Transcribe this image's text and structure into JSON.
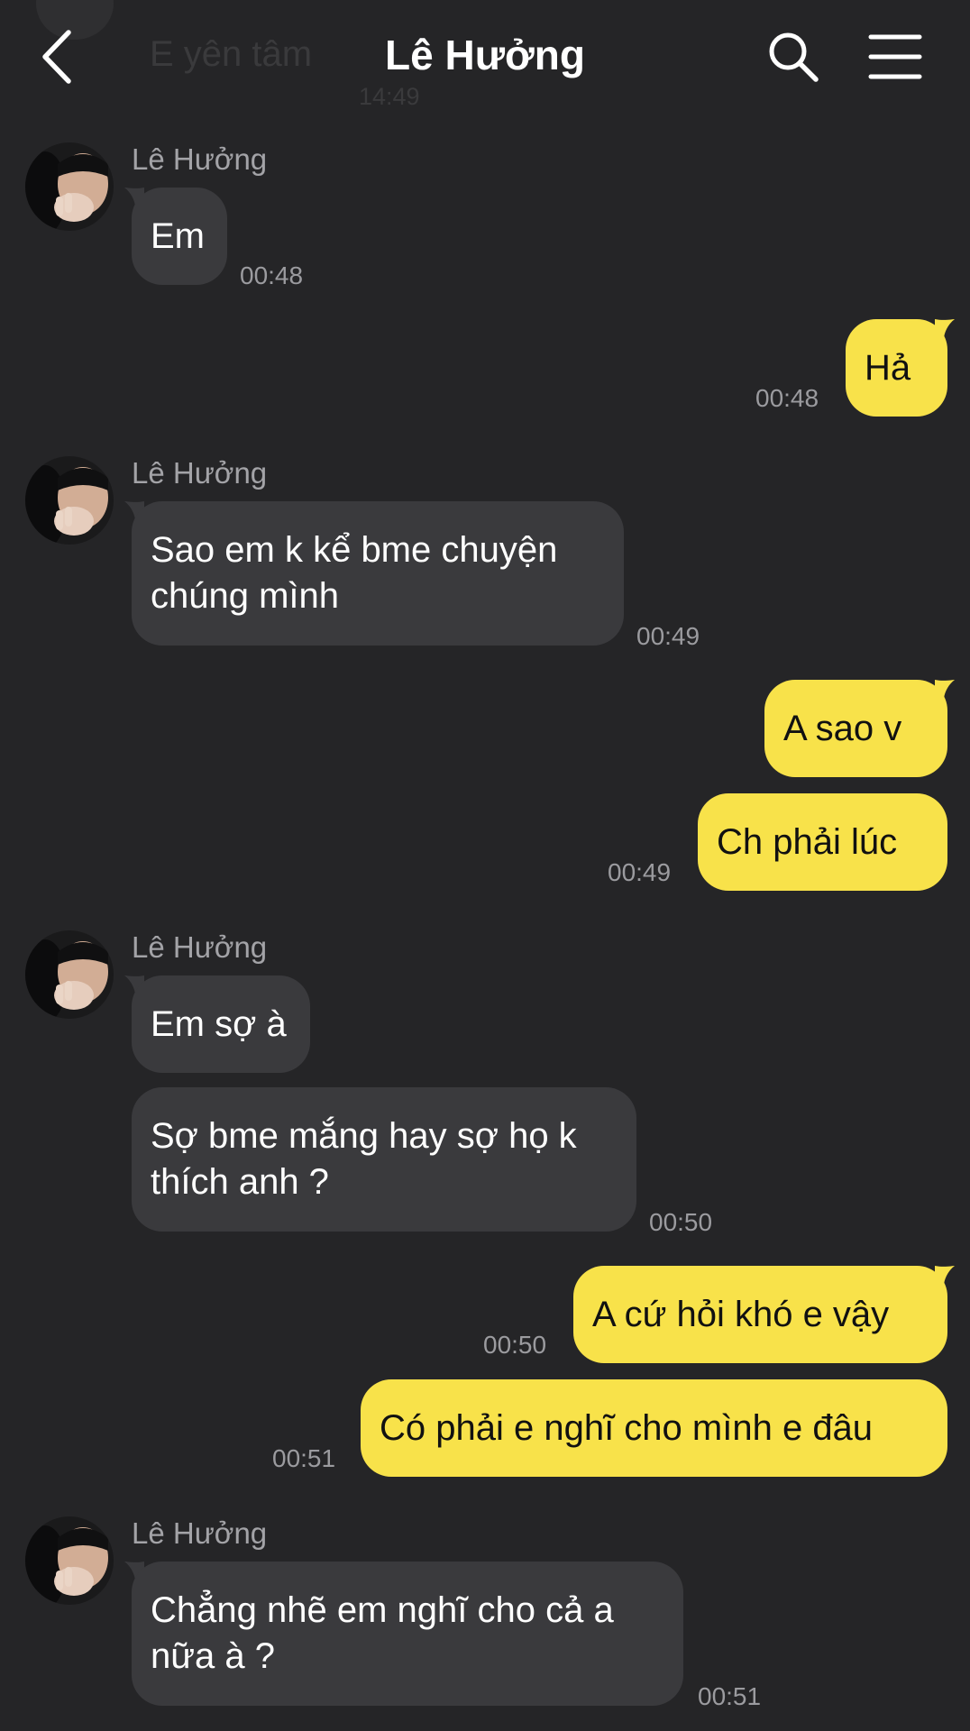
{
  "header": {
    "title": "Lê Hưởng",
    "ghost_text": "E yên tâm",
    "ghost_time": "14:49"
  },
  "messages": [
    {
      "direction": "received",
      "sender": "Lê Hưởng",
      "text": "Em",
      "time": "00:48"
    },
    {
      "direction": "sent",
      "text": "Hả",
      "time": "00:48"
    },
    {
      "direction": "received",
      "sender": "Lê Hưởng",
      "text": "Sao em k kể bme chuyện\nchúng mình",
      "time": "00:49"
    },
    {
      "direction": "sent",
      "text": "A sao v"
    },
    {
      "direction": "sent",
      "text": "Ch phải lúc",
      "time": "00:49"
    },
    {
      "direction": "received",
      "sender": "Lê Hưởng",
      "text": "Em sợ à"
    },
    {
      "direction": "received",
      "text": "Sợ bme mắng hay sợ họ k\nthích anh ?",
      "time": "00:50"
    },
    {
      "direction": "sent",
      "text": "A cứ hỏi khó e vậy",
      "time": "00:50"
    },
    {
      "direction": "sent",
      "text": "Có phải e nghĩ cho mình e đâu",
      "time": "00:51"
    },
    {
      "direction": "received",
      "sender": "Lê Hưởng",
      "text": "Chẳng nhẽ em nghĩ cho cả a\nnữa à ?",
      "time": "00:51"
    }
  ],
  "colors": {
    "background": "#252527",
    "received_bubble": "#3a3a3d",
    "sent_bubble": "#f8e24a",
    "header_text": "#ffffff",
    "timestamp": "#9b9b9f"
  },
  "icons": {
    "back": "chevron-left-icon",
    "search": "search-icon",
    "menu": "hamburger-menu-icon"
  }
}
